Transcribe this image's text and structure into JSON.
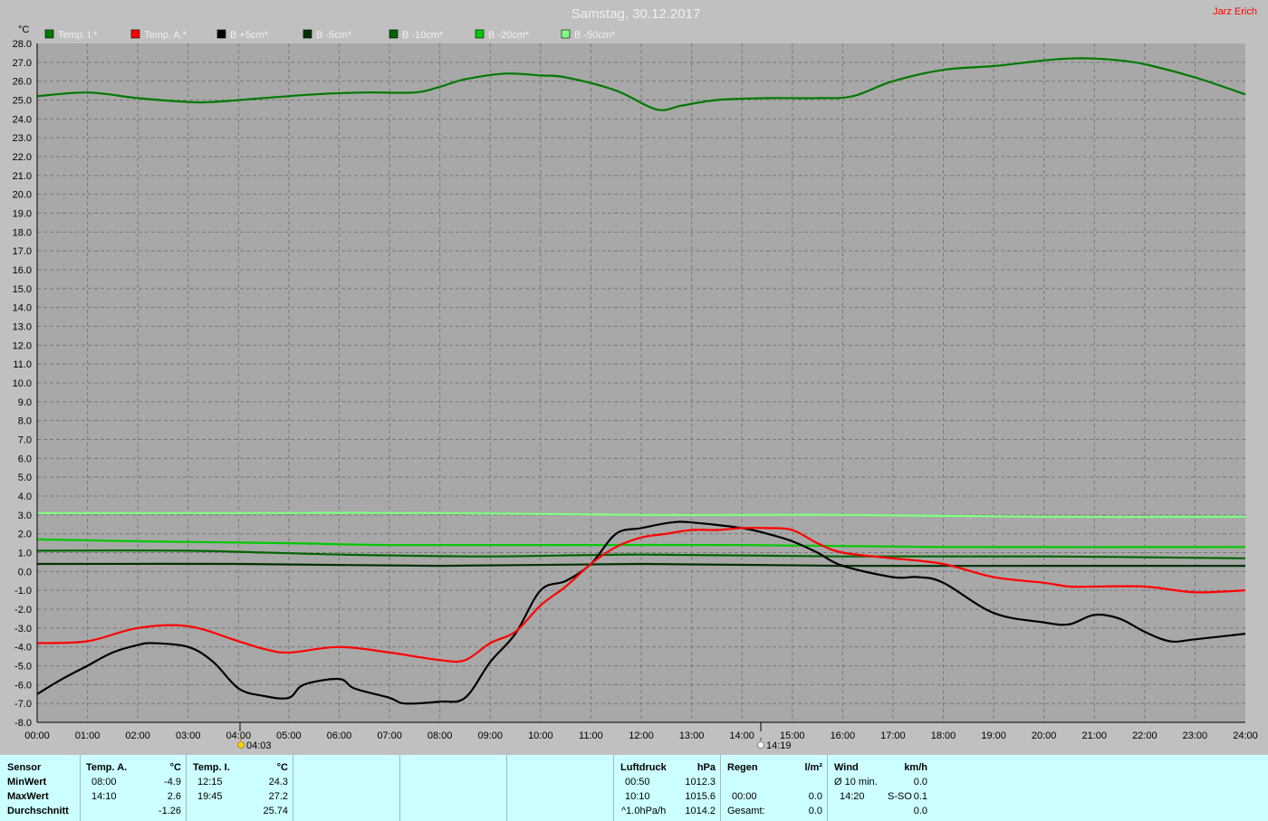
{
  "author": "Jarz Erich",
  "colors": {
    "background": "#c0c0c0",
    "plot_background": "#a8a8a8",
    "grid": "#7a7a7a",
    "temp_i": "#007800",
    "temp_a": "#ff0000",
    "b_plus5": "#000000",
    "b_minus5": "#003000",
    "b_minus10": "#006400",
    "b_minus20": "#00c800",
    "b_minus50": "#80ff80",
    "panel": "#ccffff"
  },
  "sun": {
    "rise": "04:03",
    "set": "14:19",
    "rise_icon": "sunrise-icon",
    "set_icon": "sunset-icon"
  },
  "chart_data": {
    "type": "line",
    "title": "Samstag, 30.12.2017",
    "ylabel": "°C",
    "ylim": [
      -8,
      28
    ],
    "xlim": [
      0,
      24
    ],
    "y_ticks": [
      "28.0",
      "27.0",
      "26.0",
      "25.0",
      "24.0",
      "23.0",
      "22.0",
      "21.0",
      "20.0",
      "19.0",
      "18.0",
      "17.0",
      "16.0",
      "15.0",
      "14.0",
      "13.0",
      "12.0",
      "11.0",
      "10.0",
      "9.0",
      "8.0",
      "7.0",
      "6.0",
      "5.0",
      "4.0",
      "3.0",
      "2.0",
      "1.0",
      "0.0",
      "-1.0",
      "-2.0",
      "-3.0",
      "-4.0",
      "-5.0",
      "-6.0",
      "-7.0",
      "-8.0"
    ],
    "x_ticks": [
      "00:00",
      "01:00",
      "02:00",
      "03:00",
      "04:00",
      "05:00",
      "06:00",
      "07:00",
      "08:00",
      "09:00",
      "10:00",
      "11:00",
      "12:00",
      "13:00",
      "14:00",
      "15:00",
      "16:00",
      "17:00",
      "18:00",
      "19:00",
      "20:00",
      "21:00",
      "22:00",
      "23:00",
      "24:00"
    ],
    "grid": true,
    "legend_position": "top-left",
    "series": [
      {
        "name": "Temp. I.*",
        "key": "temp_i",
        "x": [
          0,
          1,
          2,
          3,
          3.5,
          4.5,
          5.5,
          6.5,
          7.5,
          8,
          8.5,
          9.3,
          10,
          10.5,
          11.5,
          12.3,
          12.8,
          13.5,
          14.5,
          15.5,
          16.2,
          17,
          18,
          19,
          20,
          20.5,
          21,
          21.5,
          22,
          23,
          24
        ],
        "y": [
          25.2,
          25.4,
          25.1,
          24.9,
          24.9,
          25.1,
          25.3,
          25.4,
          25.4,
          25.7,
          26.1,
          26.4,
          26.3,
          26.2,
          25.5,
          24.5,
          24.7,
          25.0,
          25.1,
          25.1,
          25.2,
          26.0,
          26.6,
          26.8,
          27.1,
          27.2,
          27.2,
          27.1,
          26.9,
          26.2,
          25.3
        ]
      },
      {
        "name": "Temp. A.*",
        "key": "temp_a",
        "x": [
          0,
          1,
          2,
          3,
          4,
          4.5,
          5,
          6,
          7,
          8,
          8.5,
          9,
          9.5,
          10,
          10.5,
          11,
          11.5,
          12,
          12.5,
          13,
          13.5,
          14,
          14.5,
          15,
          15.5,
          16,
          17,
          18,
          19,
          20,
          20.5,
          21,
          22,
          23,
          24
        ],
        "y": [
          -3.8,
          -3.7,
          -3.0,
          -2.9,
          -3.7,
          -4.1,
          -4.3,
          -4.0,
          -4.3,
          -4.7,
          -4.7,
          -3.8,
          -3.2,
          -1.8,
          -0.8,
          0.4,
          1.3,
          1.8,
          2.0,
          2.2,
          2.2,
          2.3,
          2.3,
          2.2,
          1.5,
          1.0,
          0.7,
          0.4,
          -0.3,
          -0.6,
          -0.8,
          -0.8,
          -0.8,
          -1.1,
          -1.0
        ]
      },
      {
        "name": "B +5cm*",
        "key": "b_plus5",
        "x": [
          0,
          0.5,
          1,
          1.5,
          2,
          2.3,
          3,
          3.5,
          4,
          4.5,
          5,
          5.3,
          6,
          6.3,
          7,
          7.3,
          8,
          8.5,
          9,
          9.5,
          10,
          10.5,
          11,
          11.5,
          12,
          12.6,
          13,
          14,
          14.5,
          15,
          15.5,
          16,
          17,
          17.5,
          18,
          19,
          20,
          20.5,
          21,
          21.5,
          22,
          22.5,
          23,
          24
        ],
        "y": [
          -6.5,
          -5.7,
          -5.0,
          -4.3,
          -3.9,
          -3.8,
          -4.0,
          -4.8,
          -6.2,
          -6.6,
          -6.7,
          -6.0,
          -5.7,
          -6.2,
          -6.7,
          -7.0,
          -6.9,
          -6.7,
          -4.8,
          -3.3,
          -1.0,
          -0.5,
          0.4,
          2.0,
          2.3,
          2.6,
          2.6,
          2.3,
          2.0,
          1.6,
          1.0,
          0.3,
          -0.3,
          -0.3,
          -0.6,
          -2.2,
          -2.7,
          -2.8,
          -2.3,
          -2.5,
          -3.2,
          -3.7,
          -3.6,
          -3.3
        ]
      },
      {
        "name": "B -5cm*",
        "key": "b_minus5",
        "x": [
          0,
          4,
          8,
          12,
          16,
          20,
          24
        ],
        "y": [
          0.4,
          0.4,
          0.3,
          0.4,
          0.3,
          0.3,
          0.3
        ]
      },
      {
        "name": "B -10cm*",
        "key": "b_minus10",
        "x": [
          0,
          3,
          6,
          9,
          12,
          16,
          20,
          24
        ],
        "y": [
          1.1,
          1.1,
          0.9,
          0.8,
          0.9,
          0.8,
          0.8,
          0.7
        ]
      },
      {
        "name": "B -20cm*",
        "key": "b_minus20",
        "x": [
          0,
          2,
          5,
          7,
          10,
          14,
          18,
          24
        ],
        "y": [
          1.7,
          1.6,
          1.5,
          1.4,
          1.4,
          1.4,
          1.3,
          1.3
        ]
      },
      {
        "name": "B -50cm*",
        "key": "b_minus50",
        "x": [
          0,
          4,
          8,
          12,
          16,
          20,
          24
        ],
        "y": [
          3.1,
          3.1,
          3.1,
          3.0,
          3.0,
          2.9,
          2.9
        ]
      }
    ]
  },
  "stats": {
    "sensor": {
      "header": "Sensor",
      "rows": [
        "MinWert",
        "MaxWert",
        "Durchschnitt"
      ]
    },
    "temp_a": {
      "header": "Temp. A.",
      "unit": "°C",
      "min_time": "08:00",
      "min_value": "-4.9",
      "max_time": "14:10",
      "max_value": "2.6",
      "avg_value": "-1.26"
    },
    "temp_i": {
      "header": "Temp. I.",
      "unit": "°C",
      "min_time": "12:15",
      "min_value": "24.3",
      "max_time": "19:45",
      "max_value": "27.2",
      "avg_value": "25.74"
    },
    "pressure": {
      "header": "Luftdruck",
      "unit": "hPa",
      "min_time": "00:50",
      "min_value": "1012.3",
      "max_time": "10:10",
      "max_value": "1015.6",
      "trend_label": "^1.0hPa/h",
      "trend_value": "1014.2"
    },
    "rain": {
      "header": "Regen",
      "unit": "l/m²",
      "max_time": "00:00",
      "max_value": "0.0",
      "total_label": "Gesamt:",
      "total_value": "0.0"
    },
    "wind": {
      "header": "Wind",
      "unit": "km/h",
      "avg_label": "Ø 10 min.",
      "avg_value": "0.0",
      "max_time": "14:20",
      "max_dir": "S-SO",
      "max_value": "0.1",
      "third_value": "0.0"
    }
  }
}
